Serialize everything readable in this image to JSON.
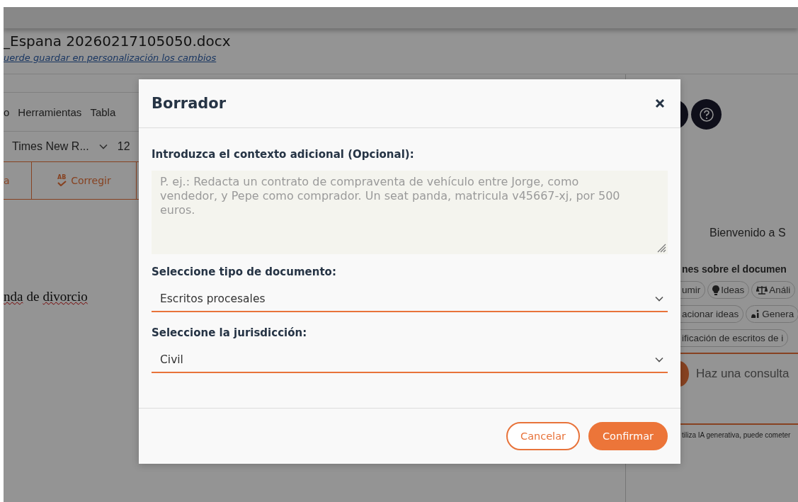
{
  "background_app": {
    "document_title": "_Espana 20260217105050.docx",
    "save_hint_link": "uerde guardar en personalización los cambios",
    "menu": [
      "o",
      "Herramientas",
      "Tabla"
    ],
    "font_name": "Times New R...",
    "font_size": "12",
    "ribbon_buttons": [
      {
        "label": "a",
        "kind": "plain"
      },
      {
        "label": "Corregir",
        "kind": "spellcheck",
        "icon_text": "AB"
      }
    ],
    "document_words": [
      {
        "text": "nda",
        "misspelled": true
      },
      {
        "text": "de",
        "misspelled": false
      },
      {
        "text": "divorcio",
        "misspelled": true
      }
    ],
    "assistant": {
      "welcome": "Bienvenido a S",
      "section_title": "nes sobre el documen",
      "chip_rows": [
        [
          {
            "label": "umir",
            "kind": "plain"
          },
          {
            "label": "Ideas",
            "kind": "bulb"
          },
          {
            "label": "Análi",
            "kind": "scale"
          }
        ],
        [
          {
            "label": "acionar ideas",
            "kind": "plain"
          },
          {
            "label": "Genera",
            "kind": "ai"
          }
        ],
        [
          {
            "label": "ificación de escritos de i",
            "kind": "plain"
          }
        ]
      ],
      "query_placeholder": "Haz una consulta",
      "disclaimer": "tiliza IA generativa, puede cometer"
    }
  },
  "dialog": {
    "title": "Borrador",
    "fields": [
      {
        "kind": "textarea",
        "label": "Introduzca el contexto adicional (Opcional):",
        "placeholder": "P. ej.: Redacta un contrato de compraventa de vehículo entre Jorge, como vendedor, y Pepe como comprador. Un seat panda, matricula v45667-xj, por 500 euros."
      },
      {
        "kind": "select",
        "label": "Seleccione tipo de documento:",
        "value": "Escritos procesales"
      },
      {
        "kind": "select",
        "label": "Seleccione la jurisdicción:",
        "value": "Civil"
      }
    ],
    "buttons": [
      {
        "label": "Cancelar",
        "kind": "secondary"
      },
      {
        "label": "Confirmar",
        "kind": "primary"
      }
    ]
  }
}
